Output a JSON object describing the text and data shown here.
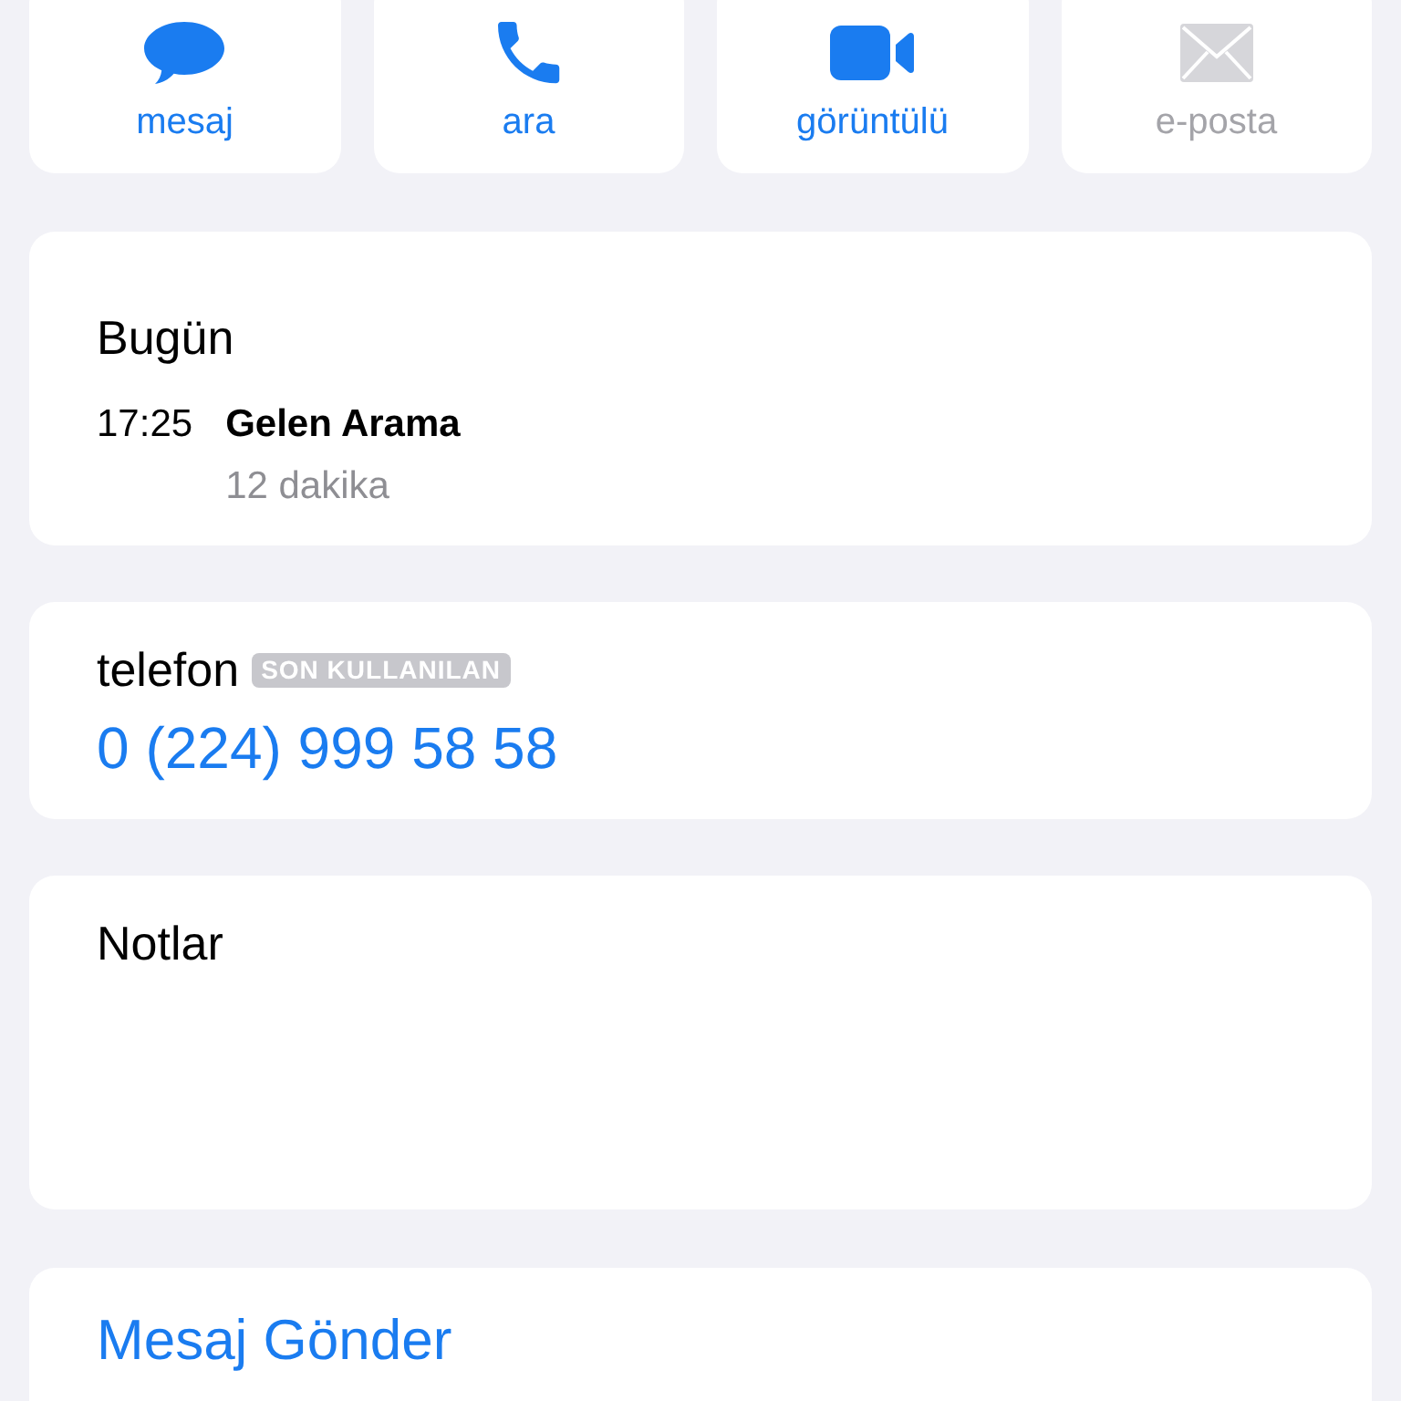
{
  "actions": [
    {
      "label": "mesaj",
      "kind": "message",
      "disabled": false
    },
    {
      "label": "ara",
      "kind": "call",
      "disabled": false
    },
    {
      "label": "görüntülü",
      "kind": "video",
      "disabled": false
    },
    {
      "label": "e-posta",
      "kind": "mail",
      "disabled": true
    }
  ],
  "recents": {
    "heading": "Bugün",
    "calls": [
      {
        "time": "17:25",
        "type": "Gelen Arama",
        "duration": "12 dakika"
      }
    ]
  },
  "phone": {
    "label": "telefon",
    "badge": "SON KULLANILAN",
    "number": "0 (224) 999 58 58"
  },
  "notes": {
    "label": "Notlar"
  },
  "send_message": {
    "label": "Mesaj Gönder"
  }
}
